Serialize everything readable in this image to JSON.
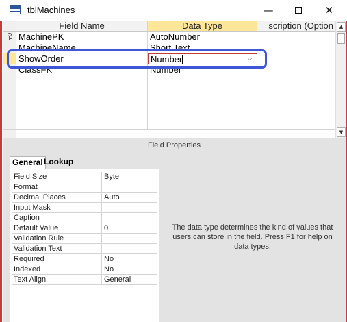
{
  "window": {
    "title": "tblMachines",
    "minimize_glyph": "—",
    "close_glyph": "✕",
    "frame_color": "#c33b3b"
  },
  "grid": {
    "columns": [
      {
        "label": "Field Name",
        "active": false
      },
      {
        "label": "Data Type",
        "active": true
      },
      {
        "label": "Description (Optional)",
        "active": false
      }
    ],
    "desc_header_visible": "scription (Option",
    "rows": [
      {
        "field_name": "MachinePK",
        "data_type": "AutoNumber",
        "description": "",
        "primary_key": true,
        "current": false
      },
      {
        "field_name": "MachineName",
        "data_type": "Short Text",
        "description": "",
        "primary_key": false,
        "current": false
      },
      {
        "field_name": "ShowOrder",
        "data_type": "Number",
        "description": "",
        "primary_key": false,
        "current": true
      },
      {
        "field_name": "ClassFK",
        "data_type": "Number",
        "description": "",
        "primary_key": false,
        "current": false
      }
    ],
    "editing": {
      "value": "Number",
      "dropdown_glyph": "⌵"
    },
    "active_header_color": "#ffe699",
    "highlight_color": "#3f56d6"
  },
  "scrollbar": {
    "up_glyph": "▲",
    "down_glyph": "▼"
  },
  "field_properties": {
    "title": "Field Properties",
    "tabs": [
      {
        "label": "General",
        "selected": true
      },
      {
        "label": "Lookup",
        "selected": false
      }
    ],
    "properties": [
      {
        "label": "Field Size",
        "value": "Byte"
      },
      {
        "label": "Format",
        "value": ""
      },
      {
        "label": "Decimal Places",
        "value": "Auto"
      },
      {
        "label": "Input Mask",
        "value": ""
      },
      {
        "label": "Caption",
        "value": ""
      },
      {
        "label": "Default Value",
        "value": "0"
      },
      {
        "label": "Validation Rule",
        "value": ""
      },
      {
        "label": "Validation Text",
        "value": ""
      },
      {
        "label": "Required",
        "value": "No"
      },
      {
        "label": "Indexed",
        "value": "No"
      },
      {
        "label": "Text Align",
        "value": "General"
      }
    ],
    "help_text": "The data type determines the kind of values that users can store in the field. Press F1 for help on data types."
  }
}
